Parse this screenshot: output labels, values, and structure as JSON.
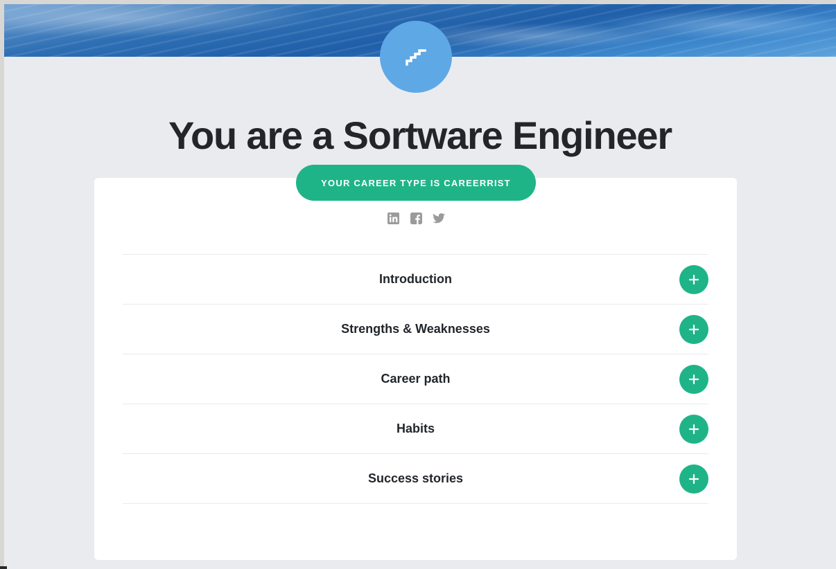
{
  "page": {
    "title": "You are a Sortware Engineer",
    "career_type_label": "YOUR CAREER TYPE IS CAREERRIST"
  },
  "icons": {
    "badge": "stairs-icon",
    "social": [
      "linkedin-icon",
      "facebook-icon",
      "twitter-icon"
    ],
    "expand": "plus-icon"
  },
  "sections": [
    {
      "label": "Introduction"
    },
    {
      "label": "Strengths & Weaknesses"
    },
    {
      "label": "Career path"
    },
    {
      "label": "Habits"
    },
    {
      "label": "Success stories"
    }
  ],
  "colors": {
    "accent_green": "#1fb488",
    "badge_blue": "#5ea8e6",
    "page_bg": "#eaebef",
    "text_dark": "#22262b",
    "icon_gray": "#9b9b9b"
  }
}
